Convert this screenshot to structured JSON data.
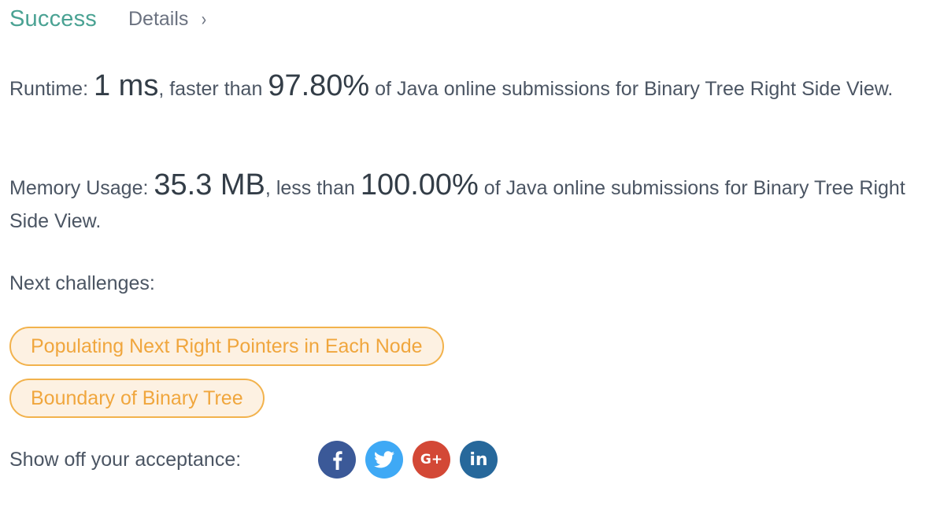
{
  "header": {
    "status": "Success",
    "details_label": "Details",
    "details_chevron": "›"
  },
  "runtime": {
    "label": "Runtime: ",
    "value": "1 ms",
    "mid": ", faster than ",
    "percent": "97.80%",
    "suffix": " of Java online submissions for Binary Tree Right Side View."
  },
  "memory": {
    "label": "Memory Usage: ",
    "value": "35.3 MB",
    "mid": ", less than ",
    "percent": "100.00%",
    "suffix": " of Java online submissions for Binary Tree Right Side View."
  },
  "next": {
    "label": "Next challenges:",
    "challenges": [
      "Populating Next Right Pointers in Each Node",
      "Boundary of Binary Tree"
    ]
  },
  "share": {
    "label": "Show off your acceptance:",
    "icons": [
      {
        "name": "facebook-icon",
        "color": "#3b5998"
      },
      {
        "name": "twitter-icon",
        "color": "#3fa9f5"
      },
      {
        "name": "google-plus-icon",
        "color": "#d34836",
        "text": "G+"
      },
      {
        "name": "linkedin-icon",
        "color": "#27689b",
        "text": "in"
      }
    ]
  },
  "colors": {
    "success": "#4aa293",
    "tag_border": "#f2b24c",
    "tag_text": "#f0a63d",
    "tag_bg": "#fdf1e2"
  }
}
